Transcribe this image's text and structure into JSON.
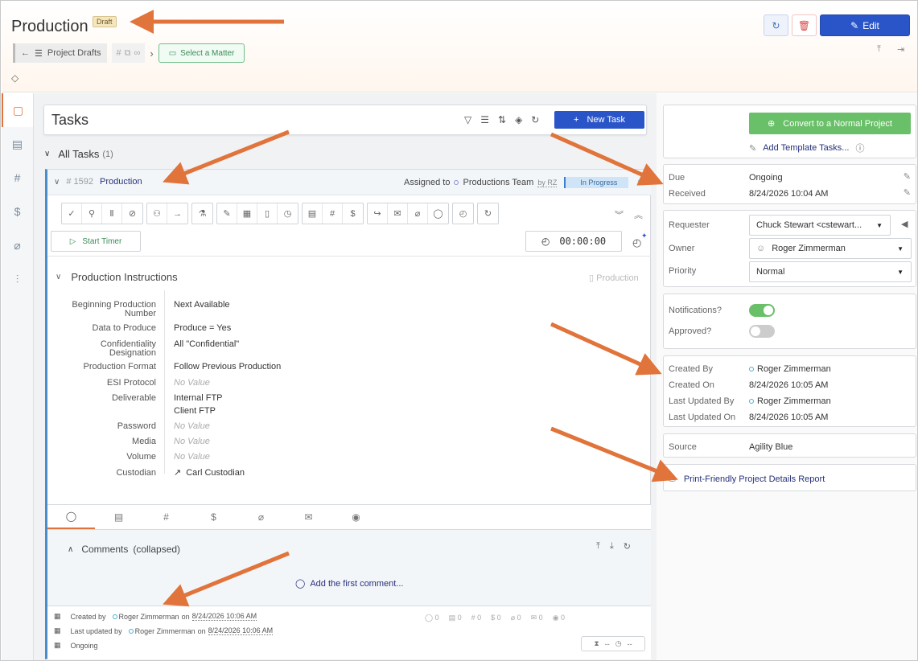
{
  "header": {
    "title": "Production",
    "draft_badge": "Draft",
    "breadcrumb_label": "Project Drafts",
    "hash_symbol": "#",
    "select_matter": "Select a Matter",
    "edit_label": "Edit"
  },
  "tasks": {
    "title": "Tasks",
    "new_task_label": "New Task",
    "all_tasks_label": "All Tasks",
    "all_tasks_count": "(1)"
  },
  "task": {
    "number": "# 1592",
    "name": "Production",
    "assigned_label": "Assigned to",
    "assigned_team": "Productions Team",
    "assigned_by": "by RZ",
    "status": "In Progress",
    "start_timer": "Start Timer",
    "timer_value": "00:00:00"
  },
  "instructions": {
    "heading": "Production Instructions",
    "tag": "Production",
    "fields": [
      {
        "label": "Beginning Production Number",
        "value": "Next Available",
        "no_value": false
      },
      {
        "label": "Data to Produce",
        "value": "Produce = Yes",
        "no_value": false
      },
      {
        "label": "Confidentiality Designation",
        "value": "All \"Confidential\"",
        "no_value": false
      },
      {
        "label": "Production Format",
        "value": "Follow Previous Production",
        "no_value": false
      },
      {
        "label": "ESI Protocol",
        "value": "No Value",
        "no_value": true
      },
      {
        "label": "Deliverable",
        "value": "Internal FTP",
        "value2": "Client FTP",
        "no_value": false
      },
      {
        "label": "Password",
        "value": "No Value",
        "no_value": true
      },
      {
        "label": "Media",
        "value": "No Value",
        "no_value": true
      },
      {
        "label": "Volume",
        "value": "No Value",
        "no_value": true
      },
      {
        "label": "Custodian",
        "value": "Carl Custodian",
        "no_value": false
      }
    ]
  },
  "comments": {
    "heading": "Comments",
    "collapsed": "(collapsed)",
    "add_first": "Add the first comment..."
  },
  "task_footer": {
    "created_by_label": "Created by",
    "created_by": "Roger Zimmerman",
    "on": "on",
    "created_on": "8/24/2026 10:06 AM",
    "updated_label": "Last updated by",
    "updated_by": "Roger Zimmerman",
    "updated_on": "8/24/2026 10:06 AM",
    "due": "Ongoing",
    "counts": [
      "0",
      "0",
      "0",
      "0",
      "0",
      "0",
      "0"
    ],
    "box_left": "--",
    "box_right": "--"
  },
  "right": {
    "convert_label": "Convert to a Normal Project",
    "add_template": "Add Template Tasks...",
    "due_label": "Due",
    "due_value": "Ongoing",
    "received_label": "Received",
    "received_value": "8/24/2026 10:04 AM",
    "requester_label": "Requester",
    "requester_value": "Chuck Stewart <cstewart...",
    "owner_label": "Owner",
    "owner_value": "Roger Zimmerman",
    "priority_label": "Priority",
    "priority_value": "Normal",
    "notifications_label": "Notifications?",
    "notifications_on": true,
    "approved_label": "Approved?",
    "approved_on": false,
    "created_by_label": "Created By",
    "created_by": "Roger Zimmerman",
    "created_on_label": "Created On",
    "created_on": "8/24/2026 10:05 AM",
    "updated_by_label": "Last Updated By",
    "updated_by": "Roger Zimmerman",
    "updated_on_label": "Last Updated On",
    "updated_on": "8/24/2026 10:05 AM",
    "source_label": "Source",
    "source_value": "Agility Blue",
    "print_label": "Print-Friendly Project Details Report"
  },
  "colors": {
    "accent_orange": "#e0743a",
    "primary_blue": "#2a55c9",
    "green": "#6abf69"
  }
}
